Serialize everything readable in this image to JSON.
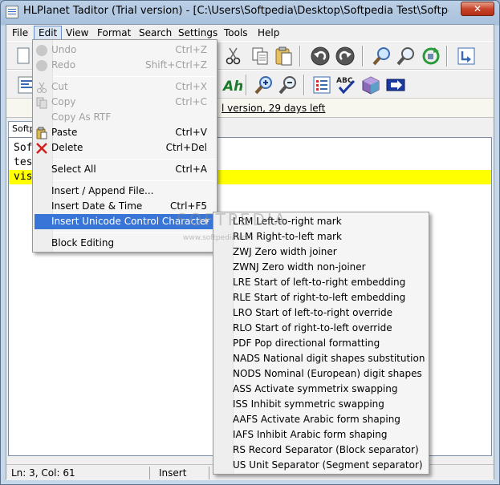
{
  "window": {
    "title": "HLPlanet Taditor (Trial version) - [C:\\Users\\Softpedia\\Desktop\\Softpedia Test\\Softpedia.t...",
    "close_glyph": "✕"
  },
  "menubar": [
    "File",
    "Edit",
    "View",
    "Format",
    "Search",
    "Settings",
    "Tools",
    "Help"
  ],
  "info": {
    "trial": "l version, 29 days left"
  },
  "tab": {
    "label": "Softpe"
  },
  "editor": {
    "lines": [
      "Sof",
      "tes",
      "vis"
    ]
  },
  "status": {
    "position": "Ln: 3, Col: 61",
    "mode": "Insert"
  },
  "edit_menu": {
    "items": [
      {
        "label": "Undo",
        "shortcut": "Ctrl+Z",
        "icon": "undo-icon"
      },
      {
        "label": "Redo",
        "shortcut": "Shift+Ctrl+Z",
        "icon": "redo-icon"
      },
      {
        "label": "Cut",
        "shortcut": "Ctrl+X",
        "icon": "cut-icon"
      },
      {
        "label": "Copy",
        "shortcut": "Ctrl+C",
        "icon": "copy-icon"
      },
      {
        "label": "Copy As RTF",
        "shortcut": ""
      },
      {
        "label": "Paste",
        "shortcut": "Ctrl+V",
        "icon": "paste-icon"
      },
      {
        "label": "Delete",
        "shortcut": "Ctrl+Del",
        "icon": "delete-icon"
      },
      {
        "label": "Select All",
        "shortcut": "Ctrl+A"
      },
      {
        "label": "Insert / Append File...",
        "shortcut": ""
      },
      {
        "label": "Insert Date & Time",
        "shortcut": "Ctrl+F5"
      },
      {
        "label": "Insert Unicode Control Character",
        "shortcut": ""
      },
      {
        "label": "Block Editing",
        "shortcut": ""
      }
    ]
  },
  "unicode_menu": {
    "items": [
      {
        "code": "LRM",
        "desc": "Left-to-right mark"
      },
      {
        "code": "RLM",
        "desc": "Right-to-left mark"
      },
      {
        "code": "ZWJ",
        "desc": "Zero width joiner"
      },
      {
        "code": "ZWNJ",
        "desc": "Zero width non-joiner"
      },
      {
        "code": "LRE",
        "desc": "Start of left-to-right embedding"
      },
      {
        "code": "RLE",
        "desc": "Start of right-to-left embedding"
      },
      {
        "code": "LRO",
        "desc": "Start of left-to-right override"
      },
      {
        "code": "RLO",
        "desc": "Start of right-to-left override"
      },
      {
        "code": "PDF",
        "desc": "Pop directional formatting"
      },
      {
        "code": "NADS",
        "desc": "National digit shapes substitution"
      },
      {
        "code": "NODS",
        "desc": "Nominal (European) digit shapes"
      },
      {
        "code": "ASS",
        "desc": "Activate symmetrix swapping"
      },
      {
        "code": "ISS",
        "desc": "Inhibit symmetric swapping"
      },
      {
        "code": "AAFS",
        "desc": "Activate Arabic form shaping"
      },
      {
        "code": "IAFS",
        "desc": "Inhibit Arabic form shaping"
      },
      {
        "code": "RS",
        "desc": "Record Separator (Block separator)"
      },
      {
        "code": "US",
        "desc": "Unit Separator (Segment separator)"
      }
    ]
  },
  "watermark": {
    "brand": "SOFTPEDIA",
    "url": "www.softpedia.com"
  }
}
